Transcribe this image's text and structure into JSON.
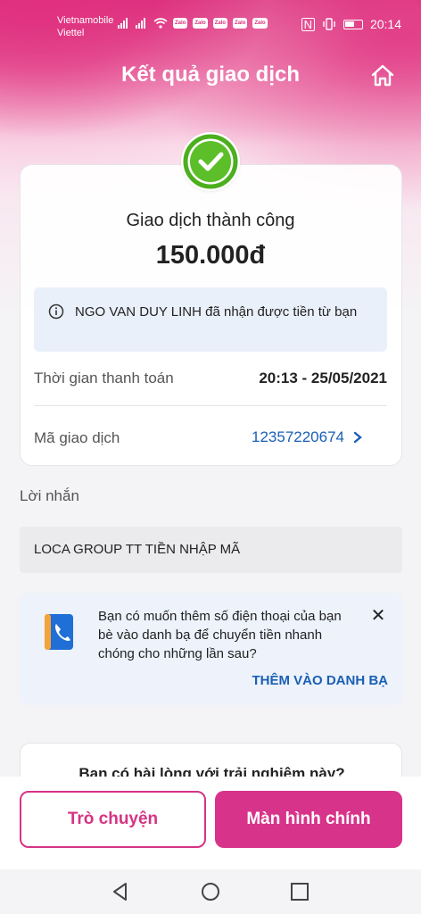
{
  "status_bar": {
    "carrier_1": "Vietnamobile",
    "carrier_2": "Viettel",
    "notif_label": "Zalo",
    "time": "20:14"
  },
  "header": {
    "title": "Kết quả giao dịch",
    "home_icon": "home-icon"
  },
  "result": {
    "status": "Giao dịch thành công",
    "amount": "150.000đ",
    "info_message": "NGO VAN DUY LINH đã nhận được tiền từ bạn",
    "payment_time_label": "Thời gian thanh toán",
    "payment_time_value": "20:13 - 25/05/2021",
    "transaction_id_label": "Mã giao dịch",
    "transaction_id_value": "12357220674"
  },
  "message": {
    "label": "Lời nhắn",
    "text": "LOCA GROUP TT TIỀN NHẬP MÃ"
  },
  "contact_prompt": {
    "text": "Bạn có muốn thêm số điện thoại của bạn bè vào danh bạ để chuyển tiền nhanh chóng cho những lần sau?",
    "action": "THÊM VÀO DANH BẠ"
  },
  "rating": {
    "question": "Bạn có hài lòng với trải nghiệm này?"
  },
  "actions": {
    "chat": "Trò chuyện",
    "home": "Màn hình chính"
  },
  "colors": {
    "brand_pink": "#d8338a",
    "success_green": "#4caf1e",
    "link_blue": "#1a5fb4"
  }
}
